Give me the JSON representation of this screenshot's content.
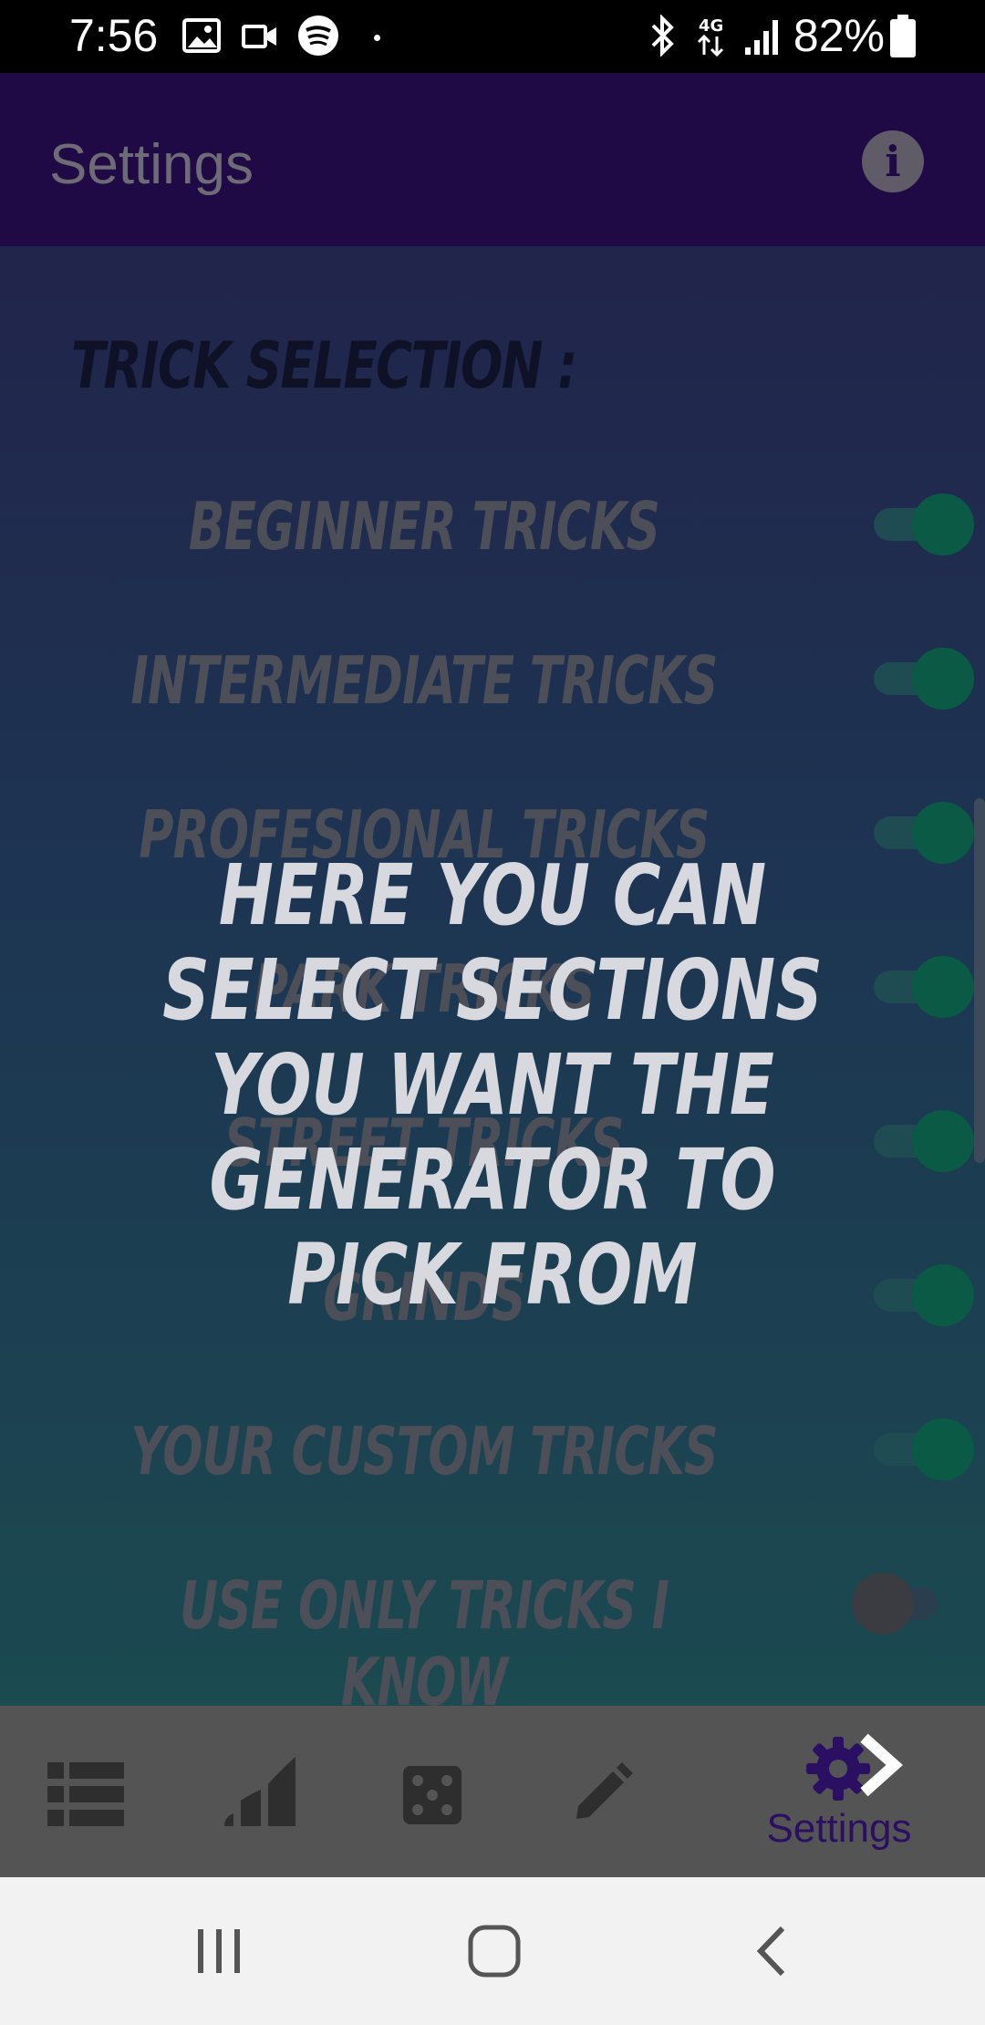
{
  "status_bar": {
    "time": "7:56",
    "battery": "82%",
    "icons": [
      "image-icon",
      "video-icon",
      "spotify-icon",
      "dot-icon",
      "bluetooth-icon",
      "4g-icon",
      "signal-icon",
      "battery-icon"
    ]
  },
  "app_bar": {
    "title": "Settings",
    "info_icon_glyph": "i"
  },
  "section": {
    "title": "TRICK SELECTION :"
  },
  "options": [
    {
      "label": "BEGINNER TRICKS",
      "enabled": true
    },
    {
      "label": "INTERMEDIATE TRICKS",
      "enabled": true
    },
    {
      "label": "PROFESIONAL TRICKS",
      "enabled": true
    },
    {
      "label": "PARK TRICKS",
      "enabled": true
    },
    {
      "label": "STREET TRICKS",
      "enabled": true
    },
    {
      "label": "GRINDS",
      "enabled": true
    },
    {
      "label": "YOUR CUSTOM TRICKS",
      "enabled": true
    },
    {
      "label": "USE ONLY TRICKS I KNOW",
      "enabled": false
    }
  ],
  "overlay": {
    "line1": "HERE YOU CAN SELECT SECTIONS",
    "line2": "YOU WANT THE GENERATOR TO",
    "line3": "PICK FROM"
  },
  "bottom_nav": {
    "items": [
      {
        "icon": "list-icon"
      },
      {
        "icon": "stats-icon"
      },
      {
        "icon": "dice-icon"
      },
      {
        "icon": "pencil-icon"
      },
      {
        "icon": "gear-icon",
        "label": "Settings"
      }
    ]
  },
  "colors": {
    "app_bar": "#1f0a45",
    "switch_on": "#0b5a45",
    "active_nav": "#2a0f63"
  }
}
